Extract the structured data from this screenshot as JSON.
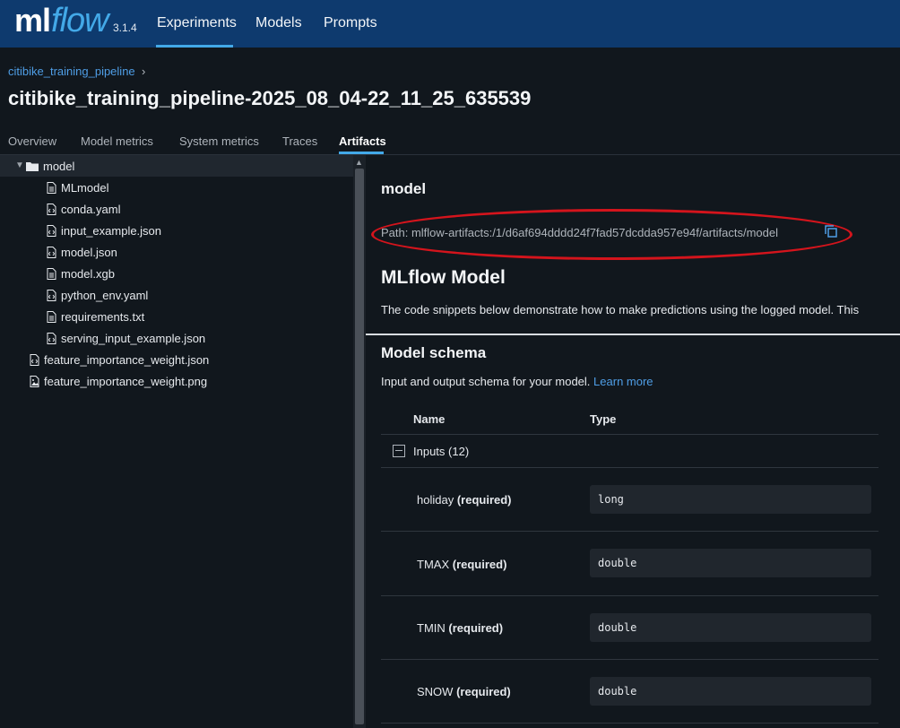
{
  "app": {
    "logo_ml": "ml",
    "logo_flow": "flow",
    "version": "3.1.4",
    "brand_color": "#43a9e8"
  },
  "nav": {
    "items": [
      {
        "label": "Experiments",
        "active": true
      },
      {
        "label": "Models",
        "active": false
      },
      {
        "label": "Prompts",
        "active": false
      }
    ]
  },
  "header": {
    "breadcrumb": "citibike_training_pipeline",
    "breadcrumb_sep": "›",
    "title": "citibike_training_pipeline-2025_08_04-22_11_25_635539"
  },
  "tabs": [
    {
      "label": "Overview",
      "active": false
    },
    {
      "label": "Model metrics",
      "active": false
    },
    {
      "label": "System metrics",
      "active": false
    },
    {
      "label": "Traces",
      "active": false
    },
    {
      "label": "Artifacts",
      "active": true
    }
  ],
  "tree": {
    "items": [
      {
        "label": "model",
        "icon": "folder-icon",
        "expanded": true,
        "selected": true
      },
      {
        "label": "MLmodel",
        "icon": "file-icon"
      },
      {
        "label": "conda.yaml",
        "icon": "code-file-icon"
      },
      {
        "label": "input_example.json",
        "icon": "code-file-icon"
      },
      {
        "label": "model.json",
        "icon": "code-file-icon"
      },
      {
        "label": "model.xgb",
        "icon": "file-icon"
      },
      {
        "label": "python_env.yaml",
        "icon": "code-file-icon"
      },
      {
        "label": "requirements.txt",
        "icon": "file-icon"
      },
      {
        "label": "serving_input_example.json",
        "icon": "code-file-icon"
      },
      {
        "label": "feature_importance_weight.json",
        "icon": "code-file-icon"
      },
      {
        "label": "feature_importance_weight.png",
        "icon": "image-file-icon"
      }
    ]
  },
  "panel": {
    "title": "model",
    "path": "Path: mlflow-artifacts:/1/d6af694dddd24f7fad57dcdda957e94f/artifacts/model",
    "mlflow_model_title": "MLflow Model",
    "snippet_desc": "The code snippets below demonstrate how to make predictions using the logged model. This",
    "annotation_color": "#d4141c"
  },
  "schema": {
    "title": "Model schema",
    "desc": "Input and output schema for your model.",
    "learn_more": "Learn more",
    "col_name": "Name",
    "col_type": "Type",
    "inputs_label": "Inputs (12)",
    "fields": [
      {
        "name": "holiday",
        "required": "(required)",
        "type": "long"
      },
      {
        "name": "TMAX",
        "required": "(required)",
        "type": "double"
      },
      {
        "name": "TMIN",
        "required": "(required)",
        "type": "double"
      },
      {
        "name": "SNOW",
        "required": "(required)",
        "type": "double"
      }
    ]
  }
}
